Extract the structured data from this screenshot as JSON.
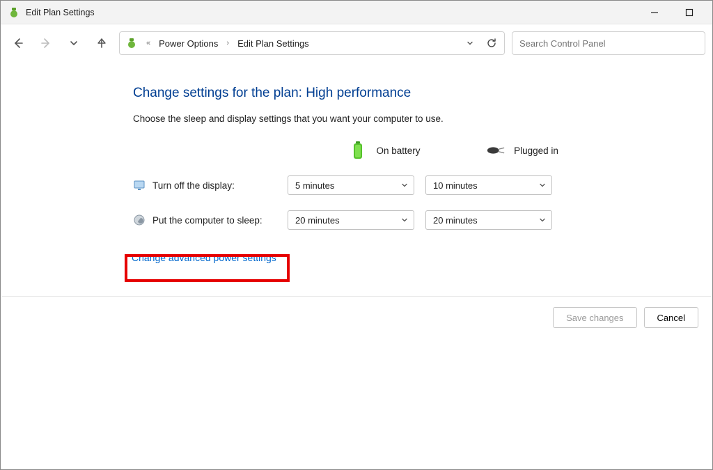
{
  "titlebar": {
    "title": "Edit Plan Settings"
  },
  "breadcrumb": {
    "parent": "Power Options",
    "current": "Edit Plan Settings"
  },
  "search": {
    "placeholder": "Search Control Panel"
  },
  "heading": "Change settings for the plan: High performance",
  "subtext": "Choose the sleep and display settings that you want your computer to use.",
  "columns": {
    "battery": "On battery",
    "plugged": "Plugged in"
  },
  "settings": {
    "display": {
      "label": "Turn off the display:",
      "battery": "5 minutes",
      "plugged": "10 minutes"
    },
    "sleep": {
      "label": "Put the computer to sleep:",
      "battery": "20 minutes",
      "plugged": "20 minutes"
    }
  },
  "advanced_link": "Change advanced power settings",
  "buttons": {
    "save": "Save changes",
    "cancel": "Cancel"
  }
}
